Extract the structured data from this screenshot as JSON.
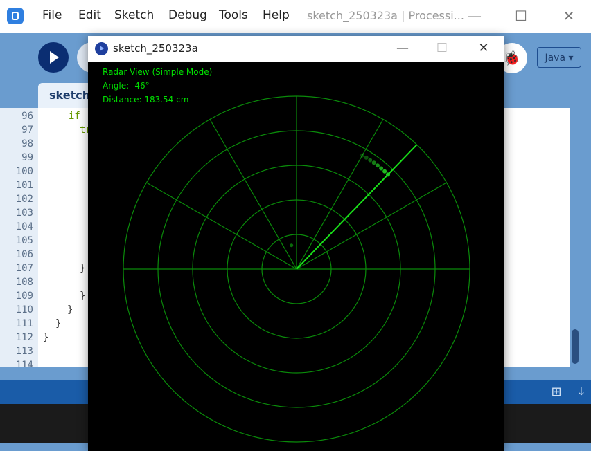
{
  "ide": {
    "menu": [
      "File",
      "Edit",
      "Sketch",
      "Debug",
      "Tools",
      "Help"
    ],
    "window_title": "sketch_250323a | Processi...",
    "tab_label": "sketch",
    "mode_label": "Java ▾",
    "debug_glyph": "🐞",
    "line_numbers": [
      "96",
      "97",
      "98",
      "99",
      "100",
      "101",
      "102",
      "103",
      "104",
      "105",
      "106",
      "107",
      "108",
      "109",
      "110",
      "111",
      "112",
      "113",
      "114"
    ],
    "code_visible": {
      "l96": "if (",
      "l97": "tr",
      "l107": "}",
      "l109": "}",
      "l110": "}",
      "l111": "}",
      "l112": "}"
    },
    "window_controls": {
      "minimize": "—",
      "maximize": "☐",
      "close": "✕"
    }
  },
  "sketch": {
    "title": "sketch_250323a",
    "controls": {
      "minimize": "—",
      "maximize": "☐",
      "close": "✕"
    },
    "hud": {
      "mode": "Radar View (Simple Mode)",
      "angle": "Angle: -46°",
      "distance": "Distance: 183.54 cm"
    },
    "radar": {
      "sweep_angle_deg": -46,
      "ring_count": 5,
      "spoke_angles_deg": [
        0,
        30,
        60,
        90,
        120,
        150,
        180
      ],
      "trail_fraction_of_radius": 0.76,
      "trail_angles_deg": [
        -46,
        -48,
        -50,
        -52,
        -54,
        -56,
        -58,
        -60
      ],
      "stray_dot": {
        "angle_deg": 102,
        "fraction_of_radius": 0.14
      },
      "color_grid": "#0a8a0a",
      "color_sweep": "#19e019",
      "color_trail": "#22cc22"
    }
  }
}
